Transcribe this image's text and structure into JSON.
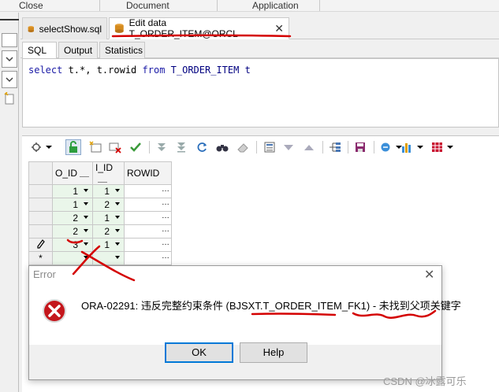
{
  "ribbon": {
    "groups": [
      "Close",
      "Document",
      "Application"
    ]
  },
  "tabs": [
    {
      "label": "selectShow.sql",
      "active": false
    },
    {
      "label": "Edit data T_ORDER_ITEM@ORCL",
      "active": true
    }
  ],
  "subtabs": [
    "SQL",
    "Output",
    "Statistics"
  ],
  "editor": {
    "line1": {
      "kw_select": "select",
      "middle": " t.*, t.rowid ",
      "kw_from": "from",
      "table": " T_ORDER_ITEM t"
    }
  },
  "grid": {
    "columns": [
      "O_ID",
      "I_ID",
      "ROWID"
    ],
    "rows": [
      {
        "marker": "",
        "o_id": "1",
        "i_id": "1",
        "rowid": "…"
      },
      {
        "marker": "",
        "o_id": "1",
        "i_id": "2",
        "rowid": "…"
      },
      {
        "marker": "",
        "o_id": "2",
        "i_id": "1",
        "rowid": "…"
      },
      {
        "marker": "",
        "o_id": "2",
        "i_id": "2",
        "rowid": "…"
      },
      {
        "marker": "pencil",
        "o_id": "3",
        "i_id": "1",
        "rowid": "…"
      },
      {
        "marker": "*",
        "o_id": "",
        "i_id": "",
        "rowid": "…"
      }
    ]
  },
  "dialog": {
    "title": "Error",
    "message": "ORA-02291: 违反完整约束条件 (BJSXT.T_ORDER_ITEM_FK1) - 未找到父项关键字",
    "ok_label": "OK",
    "help_label": "Help"
  },
  "watermark": "CSDN @冰露可乐",
  "colors": {
    "annotation_red": "#d40000",
    "grid_green": "#eaf6ea",
    "accent_blue": "#0078d7"
  }
}
